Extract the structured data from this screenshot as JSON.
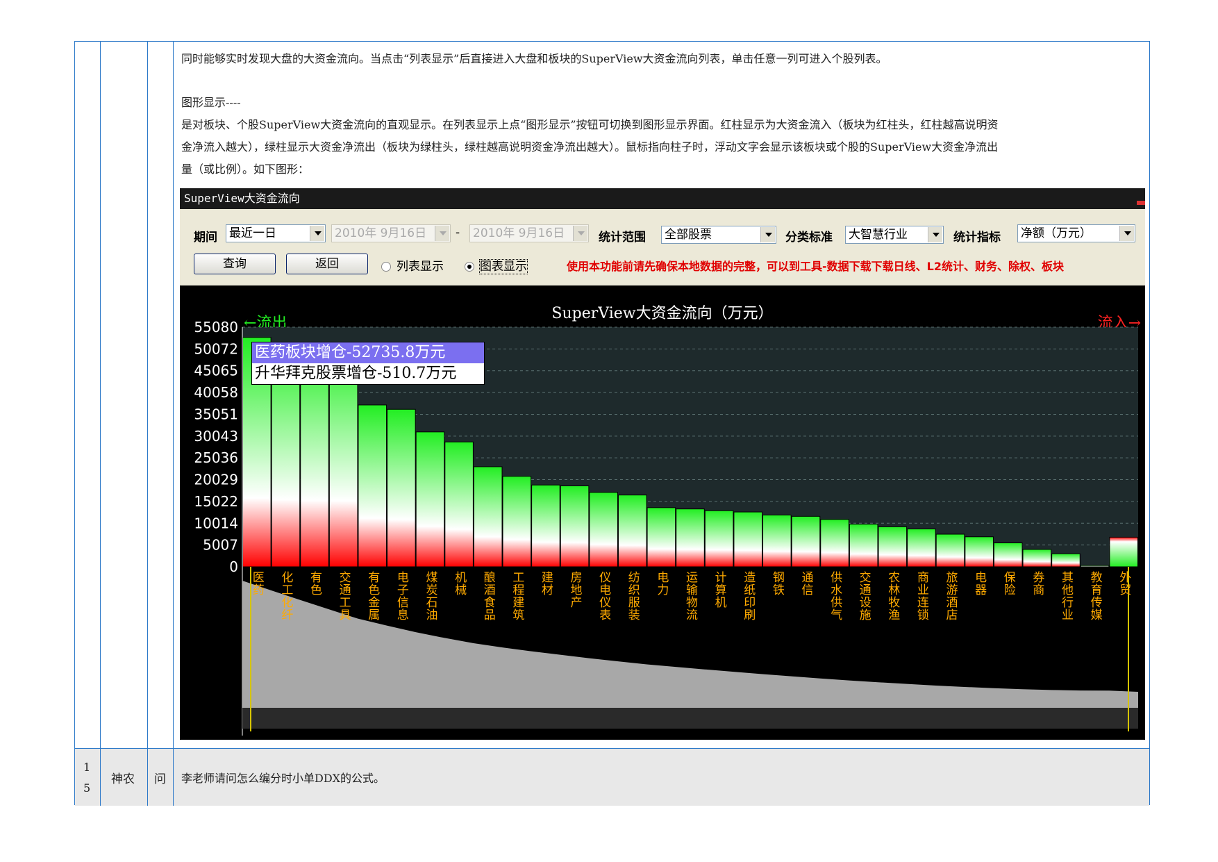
{
  "doc": {
    "para1": "同时能够实时发现大盘的大资金流向。当点击“列表显示”后直接进入大盘和板块的SuperView大资金流向列表，单击任意一列可进入个股列表。",
    "heading": "图形显示----",
    "para2_line1": "是对板块、个股SuperView大资金流向的直观显示。在列表显示上点“图形显示”按钮可切换到图形显示界面。红柱显示为大资金流入（板块为红柱头，红柱越高说明资",
    "para2_line2": "金净流入越大），绿柱显示大资金净流出（板块为绿柱头，绿柱越高说明资金净流出越大）。鼠标指向柱子时，浮动文字会显示该板块或个股的SuperView大资金净流出",
    "para2_line3": "量（或比例）。如下图形：",
    "row2_num": "1\n5",
    "row2_name": "神农",
    "row2_type": "问",
    "row2_text": "李老师请问怎么编分时小单DDX的公式。"
  },
  "window": {
    "title": "SuperView大资金流向"
  },
  "toolbar": {
    "period_label": "期间",
    "period_value": "最近一日",
    "date_from": "2010年 9月16日",
    "dash": "-",
    "date_to": "2010年 9月16日",
    "scope_label": "统计范围",
    "scope_value": "全部股票",
    "category_label": "分类标准",
    "category_value": "大智慧行业",
    "metric_label": "统计指标",
    "metric_value": "净额（万元）",
    "query_button": "查询",
    "back_button": "返回",
    "radio_list": "列表显示",
    "radio_chart": "图表显示",
    "warning": "使用本功能前请先确保本地数据的完整，可以到工具-数据下载下载日线、L2统计、财务、除权、板块"
  },
  "tooltip": {
    "line1": "医药板块增仓-52735.8万元",
    "line2": "升华拜克股票增仓-510.7万元"
  },
  "chart_data": {
    "type": "bar",
    "title": "SuperView大资金流向（万元）",
    "outflow_label": "←流出",
    "inflow_label": "流入→",
    "yticks": [
      "55080",
      "50072",
      "45065",
      "40058",
      "35051",
      "30043",
      "25036",
      "20029",
      "15022",
      "10014",
      "5007",
      "0"
    ],
    "ylim": [
      0,
      55080
    ],
    "grid": true,
    "categories": [
      "医药",
      "化工化纤",
      "有色",
      "交通工具",
      "有色金属",
      "电子信息",
      "煤炭石油",
      "机械",
      "酿酒食品",
      "工程建筑",
      "建材",
      "房地产",
      "仪电仪表",
      "纺织服装",
      "电力",
      "运输物流",
      "计算机",
      "造纸印刷",
      "钢铁",
      "通信",
      "供水供气",
      "交通设施",
      "农林牧渔",
      "商业连锁",
      "旅游酒店",
      "电器",
      "保险",
      "券商",
      "其他行业",
      "教育传媒",
      "外贸"
    ],
    "series": [
      {
        "values": [
          52736,
          51500,
          51000,
          50600,
          37200,
          36200,
          31000,
          28700,
          23000,
          20800,
          18800,
          18600,
          17100,
          16500,
          13600,
          13300,
          12900,
          12600,
          11900,
          11600,
          10900,
          9800,
          9200,
          8700,
          7500,
          6900,
          5500,
          4000,
          3000,
          300,
          6800
        ],
        "direction": [
          "out",
          "out",
          "out",
          "out",
          "out",
          "out",
          "out",
          "out",
          "out",
          "out",
          "out",
          "out",
          "out",
          "out",
          "out",
          "out",
          "out",
          "out",
          "out",
          "out",
          "out",
          "out",
          "out",
          "out",
          "out",
          "out",
          "out",
          "out",
          "out",
          "out",
          "in"
        ]
      }
    ]
  },
  "colors": {
    "outflow": "#22ee22",
    "inflow": "#ff2222",
    "border": "#2b78c8"
  }
}
